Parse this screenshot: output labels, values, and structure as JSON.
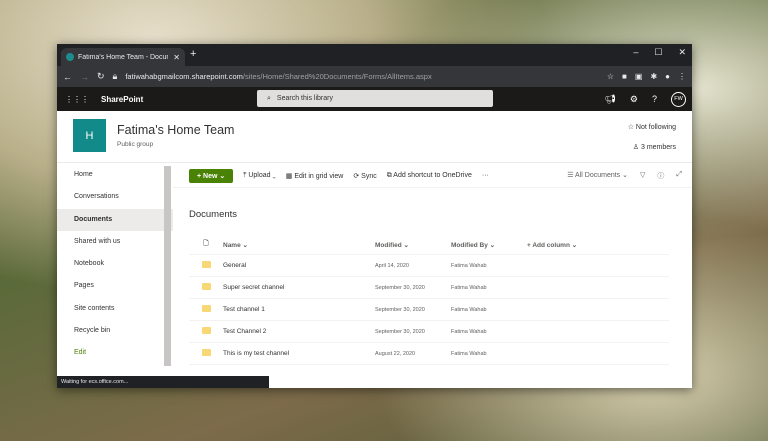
{
  "browser": {
    "tab_title": "Fatima's Home Team - Documents",
    "url_host": "fatiwahabgmailcom.sharepoint.com",
    "url_path": "/sites/Home/Shared%20Documents/Forms/AllItems.aspx",
    "status": "Waiting for ecs.office.com..."
  },
  "suite": {
    "app": "SharePoint",
    "search_placeholder": "Search this library",
    "avatar": "FW"
  },
  "site": {
    "logo_letter": "H",
    "title": "Fatima's Home Team",
    "subtitle": "Public group",
    "follow": "Not following",
    "members": "3 members"
  },
  "nav": [
    {
      "label": "Home"
    },
    {
      "label": "Conversations"
    },
    {
      "label": "Documents",
      "selected": true
    },
    {
      "label": "Shared with us"
    },
    {
      "label": "Notebook"
    },
    {
      "label": "Pages"
    },
    {
      "label": "Site contents"
    },
    {
      "label": "Recycle bin"
    },
    {
      "label": "Edit"
    }
  ],
  "commands": {
    "new": "New",
    "upload": "Upload",
    "grid": "Edit in grid view",
    "sync": "Sync",
    "shortcut": "Add shortcut to OneDrive",
    "more": "···",
    "view": "All Documents"
  },
  "library": {
    "title": "Documents",
    "columns": [
      "Name",
      "Modified",
      "Modified By",
      "+ Add column"
    ],
    "rows": [
      {
        "name": "General",
        "modified": "April 14, 2020",
        "by": "Fatima Wahab"
      },
      {
        "name": "Super secret channel",
        "modified": "September 30, 2020",
        "by": "Fatima Wahab"
      },
      {
        "name": "Test channel 1",
        "modified": "September 30, 2020",
        "by": "Fatima Wahab"
      },
      {
        "name": "Test Channel 2",
        "modified": "September 30, 2020",
        "by": "Fatima Wahab"
      },
      {
        "name": "This is my test channel",
        "modified": "August 22, 2020",
        "by": "Fatima Wahab"
      }
    ]
  },
  "colors": {
    "accent": "#498205",
    "logo": "#138a8a",
    "suite": "#1b1a19"
  }
}
